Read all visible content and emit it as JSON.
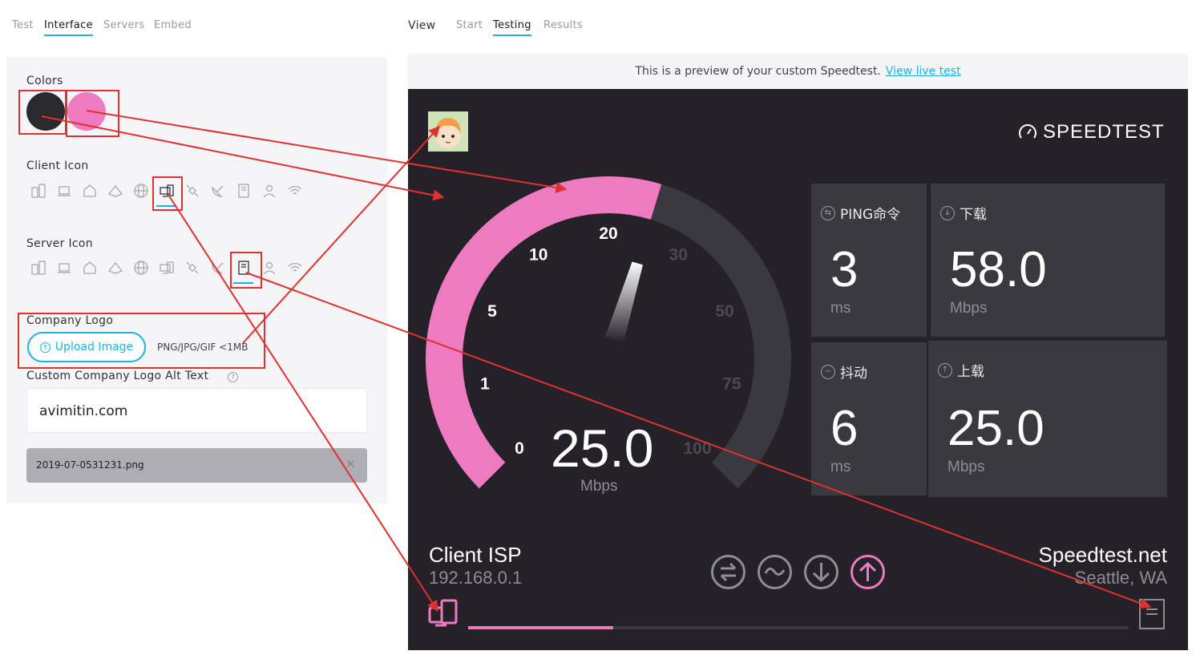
{
  "left_tabs": [
    "Test",
    "Interface",
    "Servers",
    "Embed"
  ],
  "right_tabs": {
    "view_label": "View",
    "items": [
      "Start",
      "Testing",
      "Results"
    ]
  },
  "colors": {
    "label": "Colors",
    "primary": "#2a2a2e",
    "accent": "#ee7ac0"
  },
  "client_icon": {
    "label": "Client Icon",
    "icons": [
      "devices-icon",
      "laptop-icon",
      "home-icon",
      "tent-icon",
      "globe-icon",
      "desktop-laptop-icon",
      "satellite-icon",
      "dish-icon",
      "document-icon",
      "person-icon",
      "wifi-icon"
    ],
    "selected": "desktop-laptop-icon"
  },
  "server_icon": {
    "label": "Server Icon",
    "icons": [
      "devices-icon",
      "laptop-icon",
      "home-icon",
      "tent-icon",
      "globe-icon",
      "desktop-laptop-icon",
      "satellite-icon",
      "dish-icon",
      "document-icon",
      "person-icon",
      "wifi-icon"
    ],
    "selected": "document-icon"
  },
  "company_logo": {
    "label": "Company Logo",
    "upload_label": "Upload Image",
    "hint": "PNG/JPG/GIF <1MB"
  },
  "alt_text": {
    "label": "Custom Company Logo Alt Text",
    "value": "avimitin.com"
  },
  "file": {
    "name": "2019-07-0531231.png"
  },
  "preview": {
    "text": "This is a preview of your custom Speedtest.",
    "link": "View live test"
  },
  "speedtest": {
    "brand": "SPEEDTEST",
    "gauge": {
      "ticks": [
        "0",
        "1",
        "5",
        "10",
        "20",
        "30",
        "50",
        "75",
        "100"
      ],
      "value": "25.0",
      "unit": "Mbps",
      "needle_value": 25
    },
    "ping": {
      "label": "PING命令",
      "value": "3",
      "unit": "ms"
    },
    "download": {
      "label": "下载",
      "value": "58.0",
      "unit": "Mbps"
    },
    "jitter": {
      "label": "抖动",
      "value": "6",
      "unit": "ms"
    },
    "upload": {
      "label": "上载",
      "value": "25.0",
      "unit": "Mbps"
    },
    "client": {
      "isp": "Client ISP",
      "ip": "192.168.0.1"
    },
    "server": {
      "name": "Speedtest.net",
      "location": "Seattle, WA"
    },
    "progress": 0.22
  }
}
